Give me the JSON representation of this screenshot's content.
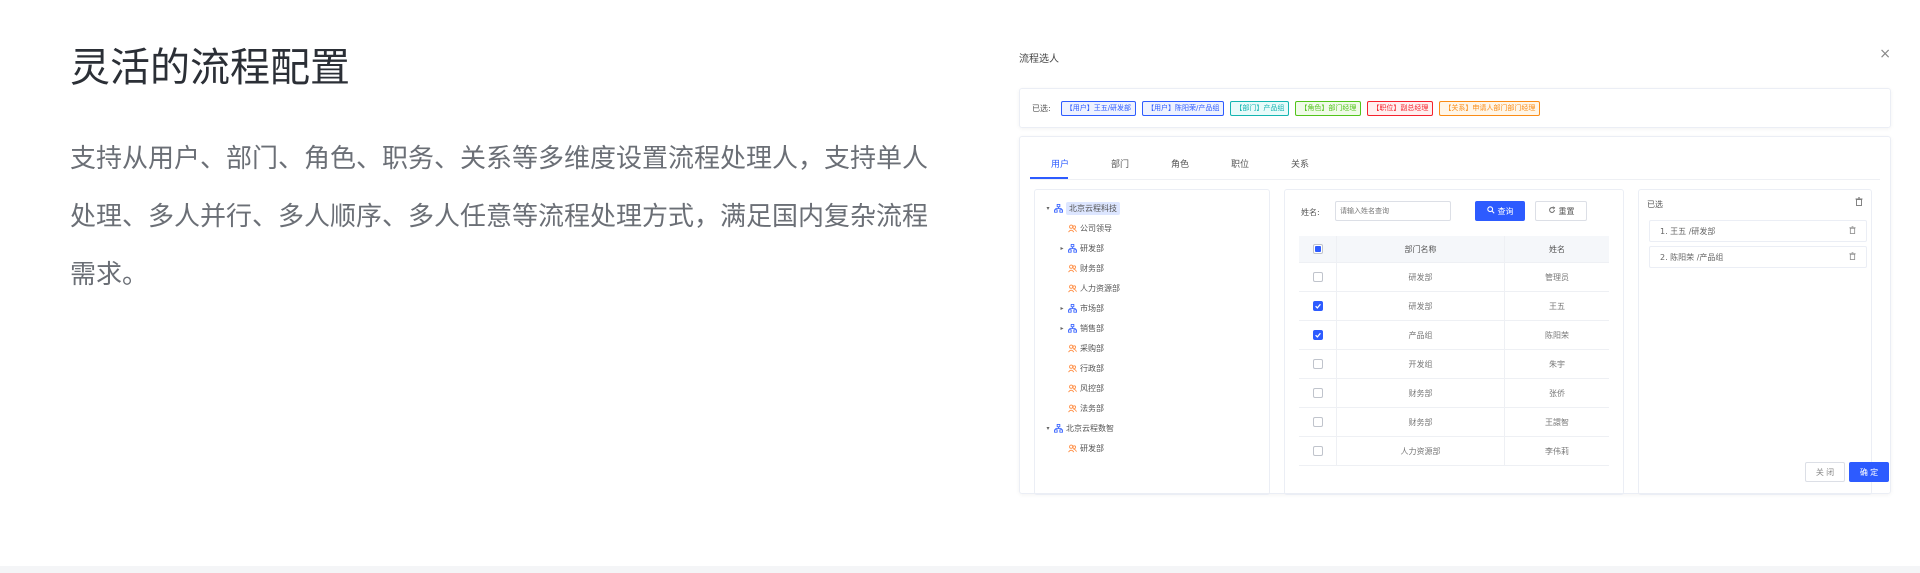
{
  "hero": {
    "title": "灵活的流程配置",
    "description": "支持从用户、部门、角色、职务、关系等多维度设置流程处理人，支持单人处理、多人并行、多人顺序、多人任意等流程处理方式，满足国内复杂流程需求。"
  },
  "modal": {
    "title": "流程选人",
    "close_icon": "×",
    "selected_label": "已选:",
    "selected_tags": [
      {
        "text": "【用户】王五/研发部",
        "color": "#2d5bff",
        "bg": "#eef2ff"
      },
      {
        "text": "【用户】陈阳荣/产品组",
        "color": "#2d5bff",
        "bg": "#eef2ff"
      },
      {
        "text": "【部门】产品组",
        "color": "#13b5b1",
        "bg": "#e8fbfa"
      },
      {
        "text": "【角色】部门经理",
        "color": "#52c41a",
        "bg": "#f0fbe8"
      },
      {
        "text": "【职位】副总经理",
        "color": "#f5222d",
        "bg": "#fff0f0"
      },
      {
        "text": "【关系】申请人部门部门经理",
        "color": "#fa8c16",
        "bg": "#fff6e8"
      }
    ],
    "tabs": [
      "用户",
      "部门",
      "角色",
      "职位",
      "关系"
    ],
    "active_tab": 0,
    "tree": [
      {
        "label": "北京云程科技",
        "type": "org",
        "level": 0,
        "caret": "expanded",
        "selected": true
      },
      {
        "label": "公司领导",
        "type": "dept",
        "level": 1,
        "caret": "none"
      },
      {
        "label": "研发部",
        "type": "org",
        "level": 1,
        "caret": "collapsed"
      },
      {
        "label": "财务部",
        "type": "dept",
        "level": 1,
        "caret": "none"
      },
      {
        "label": "人力资源部",
        "type": "dept",
        "level": 1,
        "caret": "none"
      },
      {
        "label": "市场部",
        "type": "org",
        "level": 1,
        "caret": "collapsed"
      },
      {
        "label": "销售部",
        "type": "org",
        "level": 1,
        "caret": "collapsed"
      },
      {
        "label": "采购部",
        "type": "dept",
        "level": 1,
        "caret": "none"
      },
      {
        "label": "行政部",
        "type": "dept",
        "level": 1,
        "caret": "none"
      },
      {
        "label": "风控部",
        "type": "dept",
        "level": 1,
        "caret": "none"
      },
      {
        "label": "法务部",
        "type": "dept",
        "level": 1,
        "caret": "none"
      },
      {
        "label": "北京云程数智",
        "type": "org",
        "level": 0,
        "caret": "expanded"
      },
      {
        "label": "研发部",
        "type": "dept",
        "level": 1,
        "caret": "none"
      }
    ],
    "search": {
      "label": "姓名:",
      "placeholder": "请输入姓名查询",
      "query_label": "查询",
      "reset_label": "重置"
    },
    "table": {
      "columns": [
        "部门名称",
        "姓名"
      ],
      "rows": [
        {
          "dept": "研发部",
          "name": "管理员",
          "checked": false
        },
        {
          "dept": "研发部",
          "name": "王五",
          "checked": true
        },
        {
          "dept": "产品组",
          "name": "陈阳荣",
          "checked": true
        },
        {
          "dept": "开发组",
          "name": "朱宇",
          "checked": false
        },
        {
          "dept": "财务部",
          "name": "张侨",
          "checked": false
        },
        {
          "dept": "财务部",
          "name": "王譞智",
          "checked": false
        },
        {
          "dept": "人力资源部",
          "name": "李伟莉",
          "checked": false
        }
      ]
    },
    "selected_panel": {
      "title": "已选",
      "items": [
        "1. 王五 /研发部",
        "2. 陈阳荣 /产品组"
      ]
    },
    "footer": {
      "close_label": "关 闭",
      "ok_label": "确 定"
    }
  }
}
